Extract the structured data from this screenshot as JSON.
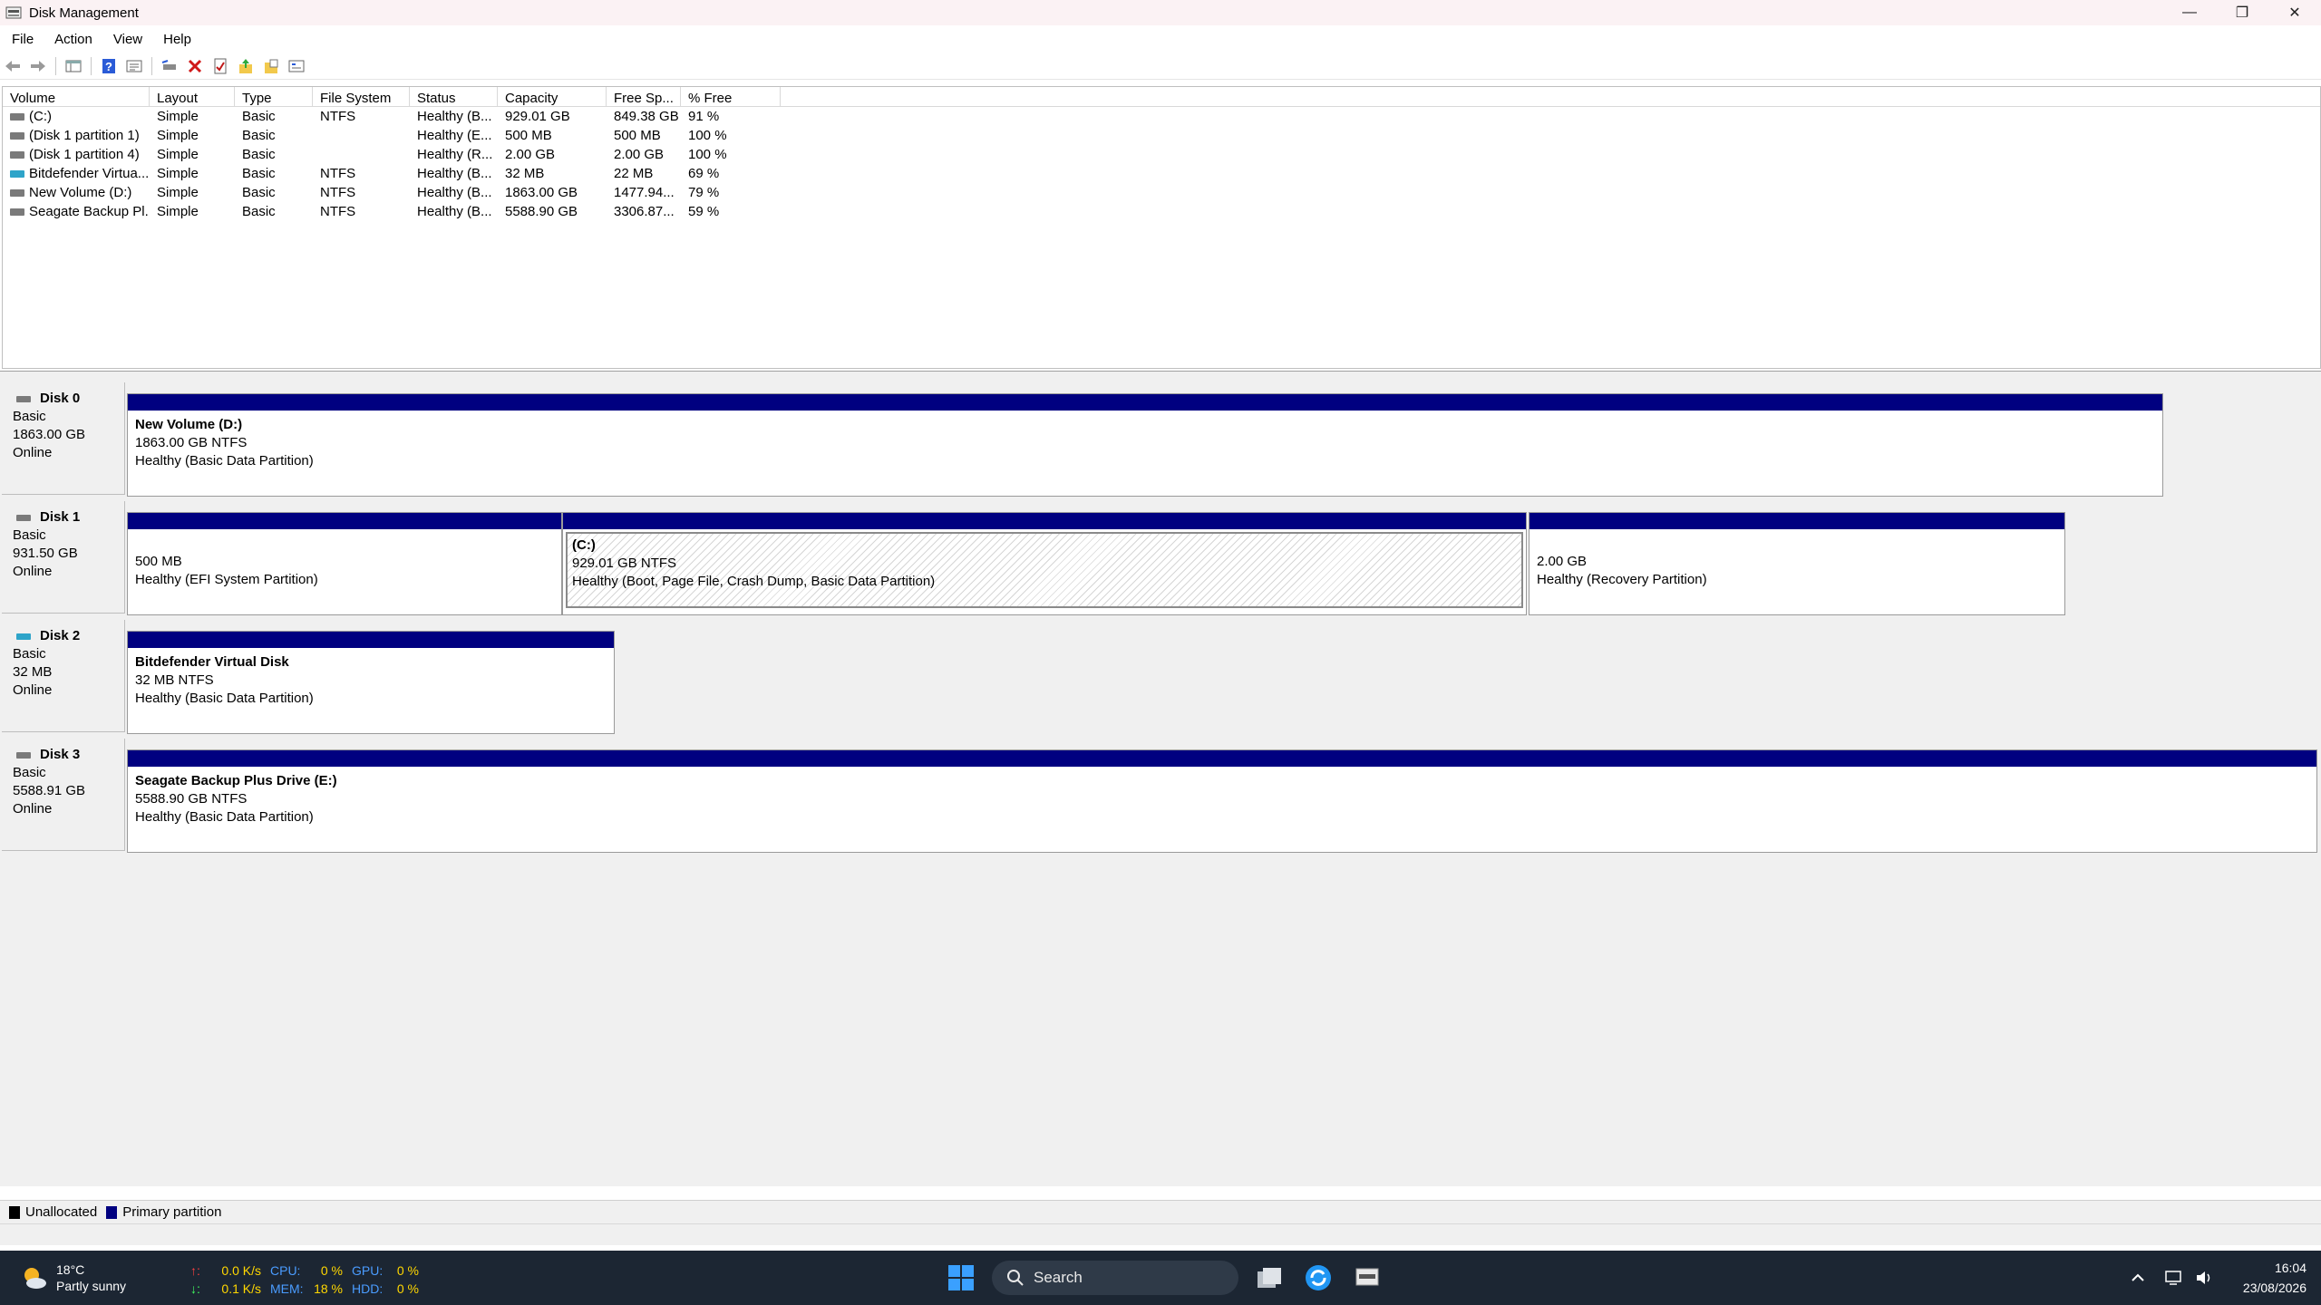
{
  "window": {
    "title": "Disk Management",
    "controls": [
      "—",
      "❐",
      "✕"
    ]
  },
  "menu": [
    "File",
    "Action",
    "View",
    "Help"
  ],
  "colors": {
    "primary_partition": "#000080",
    "unallocated": "#000000",
    "basic_disk_icon": "#7a7a7a",
    "virtual_disk_icon": "#2ea4c9",
    "taskbar": "#1c2633"
  },
  "toolbar": {
    "icons": [
      "back-icon",
      "forward-icon",
      "console-tree-icon",
      "help-icon",
      "properties-icon",
      "connect-drive-icon",
      "delete-icon",
      "check-icon",
      "export-icon",
      "folder-open-icon",
      "refresh-icon"
    ]
  },
  "volume_list": {
    "columns": [
      "Volume",
      "Layout",
      "Type",
      "File System",
      "Status",
      "Capacity",
      "Free Sp...",
      "% Free"
    ],
    "rows": [
      {
        "icon": "basic",
        "volume": "(C:)",
        "layout": "Simple",
        "type": "Basic",
        "fs": "NTFS",
        "status": "Healthy (B...",
        "capacity": "929.01 GB",
        "free": "849.38 GB",
        "pct": "91 %"
      },
      {
        "icon": "basic",
        "volume": "(Disk 1 partition 1)",
        "layout": "Simple",
        "type": "Basic",
        "fs": "",
        "status": "Healthy (E...",
        "capacity": "500 MB",
        "free": "500 MB",
        "pct": "100 %"
      },
      {
        "icon": "basic",
        "volume": "(Disk 1 partition 4)",
        "layout": "Simple",
        "type": "Basic",
        "fs": "",
        "status": "Healthy (R...",
        "capacity": "2.00 GB",
        "free": "2.00 GB",
        "pct": "100 %"
      },
      {
        "icon": "virtual",
        "volume": "Bitdefender Virtua...",
        "layout": "Simple",
        "type": "Basic",
        "fs": "NTFS",
        "status": "Healthy (B...",
        "capacity": "32 MB",
        "free": "22 MB",
        "pct": "69 %"
      },
      {
        "icon": "basic",
        "volume": "New Volume (D:)",
        "layout": "Simple",
        "type": "Basic",
        "fs": "NTFS",
        "status": "Healthy (B...",
        "capacity": "1863.00 GB",
        "free": "1477.94...",
        "pct": "79 %"
      },
      {
        "icon": "basic",
        "volume": "Seagate Backup Pl...",
        "layout": "Simple",
        "type": "Basic",
        "fs": "NTFS",
        "status": "Healthy (B...",
        "capacity": "5588.90 GB",
        "free": "3306.87...",
        "pct": "59 %"
      }
    ]
  },
  "disks": [
    {
      "name": "Disk 0",
      "type": "Basic",
      "size": "1863.00 GB",
      "state": "Online",
      "icon": "basic",
      "partitions": [
        {
          "title": "New Volume  (D:)",
          "size": "1863.00 GB NTFS",
          "status": "Healthy (Basic Data Partition)"
        }
      ]
    },
    {
      "name": "Disk 1",
      "type": "Basic",
      "size": "931.50 GB",
      "state": "Online",
      "icon": "basic",
      "partitions": [
        {
          "title": "",
          "size": "500 MB",
          "status": "Healthy (EFI System Partition)"
        },
        {
          "title": "(C:)",
          "size": "929.01 GB NTFS",
          "status": "Healthy (Boot, Page File, Crash Dump, Basic Data Partition)"
        },
        {
          "title": "",
          "size": "2.00 GB",
          "status": "Healthy (Recovery Partition)"
        }
      ]
    },
    {
      "name": "Disk 2",
      "type": "Basic",
      "size": "32 MB",
      "state": "Online",
      "icon": "virtual",
      "partitions": [
        {
          "title": "Bitdefender Virtual Disk",
          "size": "32 MB NTFS",
          "status": "Healthy (Basic Data Partition)"
        }
      ]
    },
    {
      "name": "Disk 3",
      "type": "Basic",
      "size": "5588.91 GB",
      "state": "Online",
      "icon": "basic",
      "partitions": [
        {
          "title": "Seagate Backup Plus Drive  (E:)",
          "size": "5588.90 GB NTFS",
          "status": "Healthy (Basic Data Partition)"
        }
      ]
    }
  ],
  "legend": {
    "unallocated": "Unallocated",
    "primary": "Primary partition"
  },
  "taskbar": {
    "weather": {
      "temp": "18°C",
      "desc": "Partly sunny"
    },
    "perf": {
      "up_arrow": "↑:",
      "down_arrow": "↓:",
      "up_speed": "0.0 K/s",
      "down_speed": "0.1 K/s",
      "cpu_label": "CPU:",
      "cpu": "0 %",
      "mem_label": "MEM:",
      "mem": "18 %",
      "gpu_label": "GPU:",
      "gpu": "0 %",
      "hdd_label": "HDD:",
      "hdd": "0 %"
    },
    "search_label": "Search",
    "time": "16:04",
    "date": "23/08/2026"
  }
}
